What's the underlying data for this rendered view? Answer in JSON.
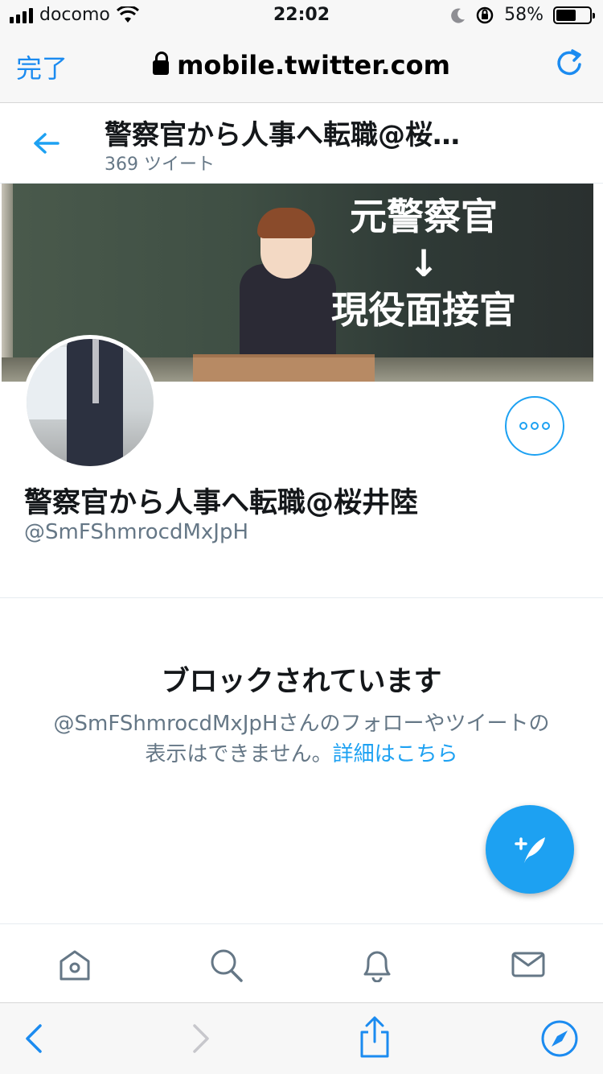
{
  "status_bar": {
    "carrier": "docomo",
    "time": "22:02",
    "battery": "58%"
  },
  "browser": {
    "done_label": "完了",
    "url": "mobile.twitter.com"
  },
  "header": {
    "title": "警察官から人事へ転職@桜…",
    "tweet_count": "369 ツイート"
  },
  "banner": {
    "line1": "元警察官",
    "arrow": "↓",
    "line2": "現役面接官"
  },
  "profile": {
    "display_name": "警察官から人事へ転職@桜井陸",
    "handle": "@SmFShmrocdMxJpH"
  },
  "blocked": {
    "title": "ブロックされています",
    "desc_line1": "@SmFShmrocdMxJpHさんのフォローやツイートの",
    "desc_line2": "表示はできません。",
    "link": "詳細はこちら"
  },
  "tabs": [
    "home-icon",
    "search-icon",
    "bell-icon",
    "mail-icon"
  ],
  "colors": {
    "accent": "#1da1f2",
    "safari_blue": "#1b8bf0",
    "secondary_text": "#657786"
  }
}
